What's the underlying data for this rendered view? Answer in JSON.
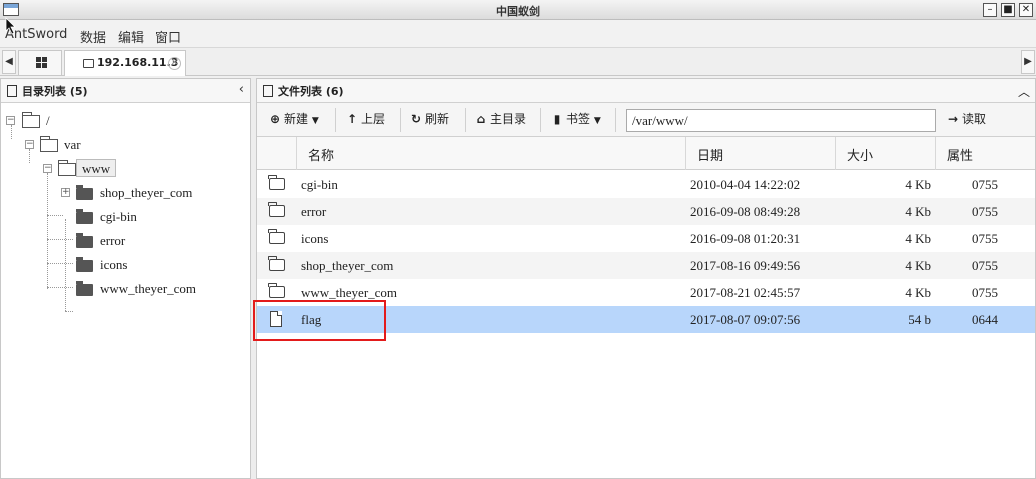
{
  "window": {
    "title": "中国蚁剑"
  },
  "menu": [
    "AntSword",
    "数据",
    "编辑",
    "窗口"
  ],
  "tabs": {
    "host": "192.168.11.3"
  },
  "tree": {
    "header": "目录列表 (5)",
    "nodes": [
      {
        "label": "/"
      },
      {
        "label": "var"
      },
      {
        "label": "www"
      },
      {
        "label": "shop_theyer_com"
      },
      {
        "label": "cgi-bin"
      },
      {
        "label": "error"
      },
      {
        "label": "icons"
      },
      {
        "label": "www_theyer_com"
      }
    ]
  },
  "files": {
    "header": "文件列表 (6)",
    "toolbar": {
      "new": "新建",
      "up": "上层",
      "refresh": "刷新",
      "home": "主目录",
      "bookmark": "书签",
      "path": "/var/www/",
      "read": "读取"
    },
    "columns": [
      "名称",
      "日期",
      "大小",
      "属性"
    ],
    "rows": [
      {
        "name": "cgi-bin",
        "date": "2010-04-04 14:22:02",
        "size": "4 Kb",
        "perm": "0755",
        "type": "folder"
      },
      {
        "name": "error",
        "date": "2016-09-08 08:49:28",
        "size": "4 Kb",
        "perm": "0755",
        "type": "folder"
      },
      {
        "name": "icons",
        "date": "2016-09-08 01:20:31",
        "size": "4 Kb",
        "perm": "0755",
        "type": "folder"
      },
      {
        "name": "shop_theyer_com",
        "date": "2017-08-16 09:49:56",
        "size": "4 Kb",
        "perm": "0755",
        "type": "folder"
      },
      {
        "name": "www_theyer_com",
        "date": "2017-08-21 02:45:57",
        "size": "4 Kb",
        "perm": "0755",
        "type": "folder"
      },
      {
        "name": "flag",
        "date": "2017-08-07 09:07:56",
        "size": "54 b",
        "perm": "0644",
        "type": "file"
      }
    ]
  }
}
